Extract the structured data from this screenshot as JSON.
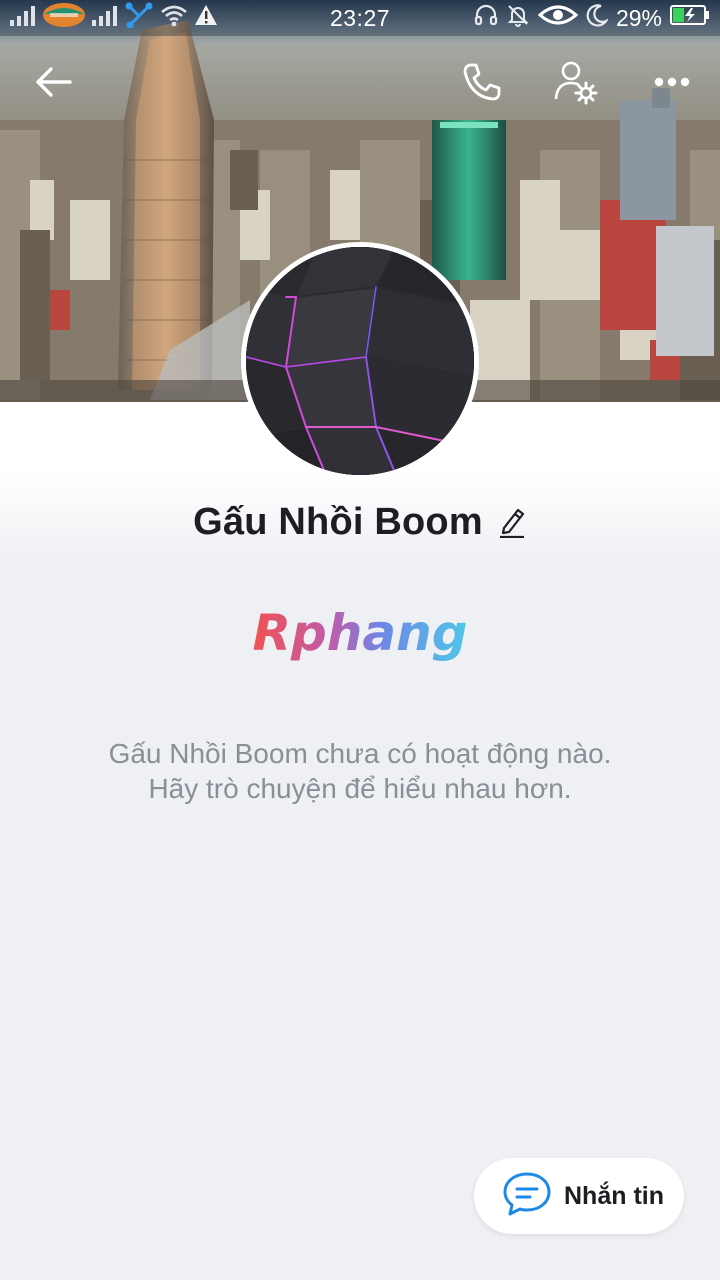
{
  "status_bar": {
    "time": "23:27",
    "battery": "29%",
    "icons": [
      "signal-bars-icon",
      "carrier-logo-icon",
      "signal-bars-icon",
      "share-icon",
      "wifi-icon",
      "warning-icon",
      "headset-icon",
      "bell-off-icon",
      "eye-icon",
      "moon-icon",
      "battery-charging-icon"
    ]
  },
  "top_nav": {
    "icons": [
      "back-arrow-icon",
      "phone-icon",
      "user-settings-icon",
      "more-dots-icon"
    ]
  },
  "profile": {
    "name": "Gấu Nhồi Boom",
    "edit_icon": "pencil-icon"
  },
  "watermark": {
    "text": "Rphang"
  },
  "empty_state": {
    "line1": "Gấu Nhồi Boom chưa có hoạt động nào.",
    "line2": "Hãy trò chuyện để hiểu nhau hơn."
  },
  "message_button": {
    "label": "Nhắn tin",
    "icon": "chat-bubble-icon"
  },
  "colors": {
    "accent": "#1f8ae6",
    "name_text": "#1c1e21",
    "muted_text": "#8a8e96",
    "background": "#eff0f4"
  }
}
